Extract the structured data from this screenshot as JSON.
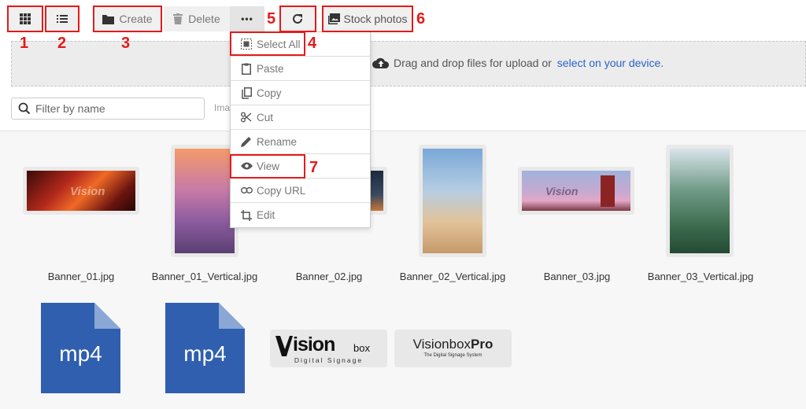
{
  "toolbar": {
    "create_label": "Create",
    "delete_label": "Delete",
    "more_label": "•••",
    "stock_label": "Stock photos"
  },
  "annotations": [
    "1",
    "2",
    "3",
    "4",
    "5",
    "6",
    "7"
  ],
  "dropzone": {
    "text": "Drag and drop files for upload or",
    "link": "select on your device."
  },
  "filter": {
    "placeholder": "Filter by name",
    "partial_label": "Ima"
  },
  "menu": {
    "items": [
      "Select All",
      "Paste",
      "Copy",
      "Cut",
      "Rename",
      "View",
      "Copy URL",
      "Edit"
    ]
  },
  "files": [
    {
      "name": "Banner_01.jpg"
    },
    {
      "name": "Banner_01_Vertical.jpg"
    },
    {
      "name": "Banner_02.jpg"
    },
    {
      "name": "Banner_02_Vertical.jpg"
    },
    {
      "name": "Banner_03.jpg"
    },
    {
      "name": "Banner_03_Vertical.jpg"
    }
  ],
  "docs": [
    {
      "ext": "mp4"
    },
    {
      "ext": "mp4"
    }
  ],
  "logos": {
    "vision_main": "ision",
    "vision_sup": "box",
    "vision_sub": "Digital Signage",
    "pro_name": "Visionbox",
    "pro_bold": "Pro",
    "pro_sub": "The Digital Signage System"
  },
  "colors": {
    "annotation": "#e31b1b",
    "link": "#2a64c8",
    "doc": "#2f5fae"
  }
}
